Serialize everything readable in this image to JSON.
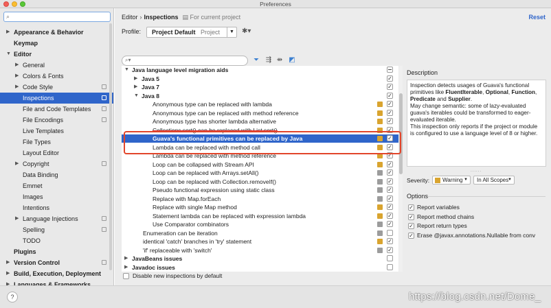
{
  "window": {
    "title": "Preferences"
  },
  "sidebar": {
    "search_placeholder": "",
    "search_icon": "search-icon",
    "items": [
      {
        "label": "Appearance & Behavior",
        "level": 0,
        "arrow": "▶",
        "bold": true
      },
      {
        "label": "Keymap",
        "level": 0,
        "arrow": "",
        "bold": true
      },
      {
        "label": "Editor",
        "level": 0,
        "arrow": "▼",
        "bold": true
      },
      {
        "label": "General",
        "level": 1,
        "arrow": "▶"
      },
      {
        "label": "Colors & Fonts",
        "level": 1,
        "arrow": "▶"
      },
      {
        "label": "Code Style",
        "level": 1,
        "arrow": "▶",
        "copy": true
      },
      {
        "label": "Inspections",
        "level": 1,
        "arrow": "",
        "selected": true,
        "copy": true
      },
      {
        "label": "File and Code Templates",
        "level": 1,
        "arrow": "",
        "copy": true
      },
      {
        "label": "File Encodings",
        "level": 1,
        "arrow": "",
        "copy": true
      },
      {
        "label": "Live Templates",
        "level": 1,
        "arrow": ""
      },
      {
        "label": "File Types",
        "level": 1,
        "arrow": ""
      },
      {
        "label": "Layout Editor",
        "level": 1,
        "arrow": ""
      },
      {
        "label": "Copyright",
        "level": 1,
        "arrow": "▶",
        "copy": true
      },
      {
        "label": "Data Binding",
        "level": 1,
        "arrow": ""
      },
      {
        "label": "Emmet",
        "level": 1,
        "arrow": ""
      },
      {
        "label": "Images",
        "level": 1,
        "arrow": ""
      },
      {
        "label": "Intentions",
        "level": 1,
        "arrow": ""
      },
      {
        "label": "Language Injections",
        "level": 1,
        "arrow": "▶",
        "copy": true
      },
      {
        "label": "Spelling",
        "level": 1,
        "arrow": "",
        "copy": true
      },
      {
        "label": "TODO",
        "level": 1,
        "arrow": ""
      },
      {
        "label": "Plugins",
        "level": 0,
        "arrow": "",
        "bold": true
      },
      {
        "label": "Version Control",
        "level": 0,
        "arrow": "▶",
        "bold": true,
        "copy": true
      },
      {
        "label": "Build, Execution, Deployment",
        "level": 0,
        "arrow": "▶",
        "bold": true
      },
      {
        "label": "Languages & Frameworks",
        "level": 0,
        "arrow": "▶",
        "bold": true
      }
    ]
  },
  "header": {
    "crumb1": "Editor",
    "separator": "›",
    "crumb2": "Inspections",
    "scope_note": "For current project",
    "reset": "Reset",
    "profile_label": "Profile:",
    "profile_name": "Project Default",
    "profile_type": "Project",
    "profile_dropdown": "▼",
    "gear": "✱▾"
  },
  "toolbar": {
    "search_icon": "⌕▾",
    "filter_icon": "⏷",
    "expand_icon": "⇶",
    "collapse_icon": "⇻",
    "reset_icon": "◩"
  },
  "tree": {
    "rows": [
      {
        "label": "Java language level migration aids",
        "level": 1,
        "arrow": "▼",
        "bold": true,
        "sev": null,
        "check": "indet"
      },
      {
        "label": "Java 5",
        "level": 2,
        "arrow": "▶",
        "bold": true,
        "sev": null,
        "check": "✓"
      },
      {
        "label": "Java 7",
        "level": 2,
        "arrow": "▶",
        "bold": true,
        "sev": null,
        "check": "✓"
      },
      {
        "label": "Java 8",
        "level": 2,
        "arrow": "▼",
        "bold": true,
        "sev": null,
        "check": "✓"
      },
      {
        "label": "Anonymous type can be replaced with lambda",
        "level": 3,
        "sev": "#d9a42f",
        "check": "✓"
      },
      {
        "label": "Anonymous type can be replaced with method reference",
        "level": 3,
        "sev": "#d9a42f",
        "check": "✓"
      },
      {
        "label": "Anonymous type has shorter lambda alternative",
        "level": 3,
        "sev": "#d9a42f",
        "check": "✓"
      },
      {
        "label": "Collections.sort() can be replaced with List.sort()",
        "level": 3,
        "sev": "#d9a42f",
        "check": "✓",
        "strike": true
      },
      {
        "label": "Guava's functional primitives can be replaced by Java",
        "level": 3,
        "sev": "#d9a42f",
        "check": "✓",
        "selected": true,
        "bold": true
      },
      {
        "label": "Lambda can be replaced with method call",
        "level": 3,
        "sev": "#d9a42f",
        "check": "✓"
      },
      {
        "label": "Lambda can be replaced with method reference",
        "level": 3,
        "sev": "#d9a42f",
        "check": "✓"
      },
      {
        "label": "Loop can be collapsed with Stream API",
        "level": 3,
        "sev": "#d9a42f",
        "check": "✓"
      },
      {
        "label": "Loop can be replaced with Arrays.setAll()",
        "level": 3,
        "sev": "#9c9c9c",
        "check": "✓"
      },
      {
        "label": "Loop can be replaced with Collection.removeIf()",
        "level": 3,
        "sev": "#9c9c9c",
        "check": "✓"
      },
      {
        "label": "Pseudo functional expression using static class",
        "level": 3,
        "sev": "#9c9c9c",
        "check": "✓"
      },
      {
        "label": "Replace with Map.forEach",
        "level": 3,
        "sev": "#9c9c9c",
        "check": "✓"
      },
      {
        "label": "Replace with single Map method",
        "level": 3,
        "sev": "#d9a42f",
        "check": "✓"
      },
      {
        "label": "Statement lambda can be replaced with expression lambda",
        "level": 3,
        "sev": "#d9a42f",
        "check": "✓"
      },
      {
        "label": "Use Comparator combinators",
        "level": 3,
        "sev": "#9c9c9c",
        "check": "✓"
      },
      {
        "label": "Enumeration can be iteration",
        "level": 2,
        "sev": "#9c9c9c",
        "check": ""
      },
      {
        "label": "identical 'catch' branches in 'try' statement",
        "level": 2,
        "sev": "#d9a42f",
        "check": "✓"
      },
      {
        "label": "'if' replaceable with 'switch'",
        "level": 2,
        "sev": "#9c9c9c",
        "check": "✓"
      },
      {
        "label": "JavaBeans issues",
        "level": 1,
        "arrow": "▶",
        "bold": true,
        "sev": null,
        "check": ""
      },
      {
        "label": "Javadoc issues",
        "level": 1,
        "arrow": "▶",
        "bold": true,
        "sev": null,
        "check": ""
      }
    ],
    "disable_new": "Disable new inspections by default"
  },
  "details": {
    "description_label": "Description",
    "description_html": "Inspection detects usages of Guava's functional primitives like <b>FluentIterable</b>, <b>Optional</b>, <b>Function</b>, <b>Predicate</b> and <b>Supplier</b>.<br>May change semantic: some of lazy-evaluated guava's iterables could be transformed to eager-evaluated iterable.<br>This inspection only reports if the project or module is configured to use a language level of 8 or higher.",
    "splitter": "......",
    "severity_label": "Severity:",
    "severity_value": "Warning",
    "severity_color": "#d9a42f",
    "scope_value": "In All Scopes",
    "dropdown": "▼",
    "options_label": "Options",
    "options": [
      {
        "label": "Report variables",
        "checked": true
      },
      {
        "label": "Report method chains",
        "checked": true
      },
      {
        "label": "Report return types",
        "checked": true
      },
      {
        "label": "Erase @javax.annotations.Nullable from conv",
        "checked": true
      }
    ]
  },
  "footer": {
    "help": "?",
    "watermark": "https://blog.csdn.net/Dome_"
  }
}
